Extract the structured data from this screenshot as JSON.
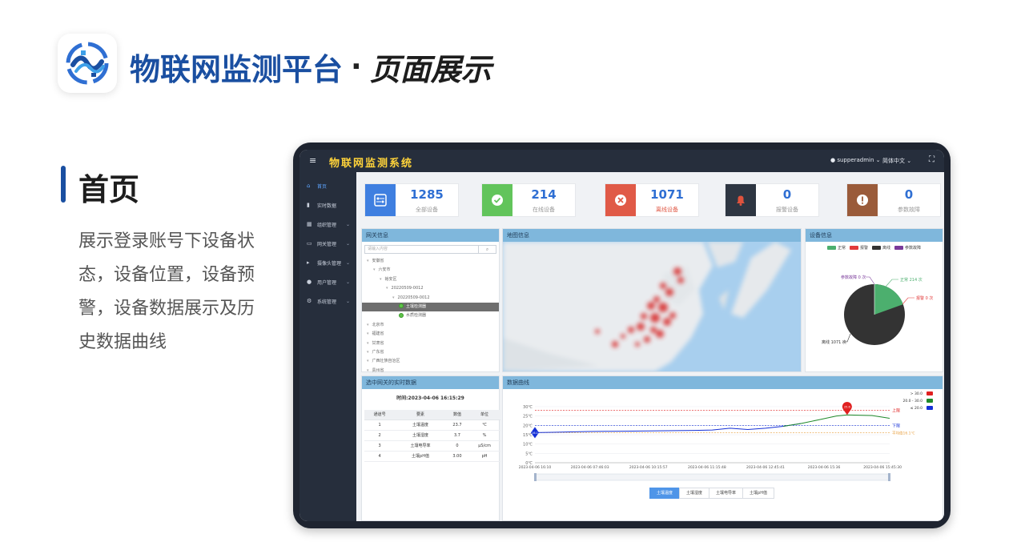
{
  "slide": {
    "title_part1": "物联网监测平台",
    "title_dot": "·",
    "title_part2": "页面展示",
    "section_title": "首页",
    "section_desc": "展示登录账号下设备状态，设备位置，设备预警，设备数据展示及历史数据曲线"
  },
  "app": {
    "menu_icon": "≡",
    "system_name": "物联网监测系统",
    "user": "supperadmin",
    "language": "简体中文",
    "fullscreen_icon": "fullscreen-icon"
  },
  "sidebar": {
    "items": [
      {
        "label": "首页",
        "icon": "home-icon"
      },
      {
        "label": "实时数据",
        "icon": "chart-icon"
      },
      {
        "label": "组织管理",
        "icon": "grid-icon"
      },
      {
        "label": "网关管理",
        "icon": "monitor-icon"
      },
      {
        "label": "摄像头管理",
        "icon": "camera-icon"
      },
      {
        "label": "用户管理",
        "icon": "user-icon"
      },
      {
        "label": "系统管理",
        "icon": "settings-icon"
      }
    ]
  },
  "stats": [
    {
      "value": "1285",
      "label": "全部设备",
      "color": "#3f7fe0",
      "icon": "device-icon"
    },
    {
      "value": "214",
      "label": "在线设备",
      "color": "#62c45b",
      "icon": "check-icon"
    },
    {
      "value": "1071",
      "label": "离线设备",
      "color": "#e05a47",
      "icon": "close-icon"
    },
    {
      "value": "0",
      "label": "报警设备",
      "color": "#2e3642",
      "icon": "bell-icon"
    },
    {
      "value": "0",
      "label": "参数故障",
      "color": "#9a5b3a",
      "icon": "warning-icon"
    }
  ],
  "gateway": {
    "title": "网关信息",
    "search_placeholder": "请输入内容",
    "tree": [
      {
        "label": "安徽省",
        "level": 0,
        "type": "node"
      },
      {
        "label": "六安市",
        "level": 1,
        "type": "node"
      },
      {
        "label": "裕安区",
        "level": 2,
        "type": "node"
      },
      {
        "label": "20220509-0012",
        "level": 3,
        "type": "node"
      },
      {
        "label": "20220509-0012",
        "level": 4,
        "type": "node"
      },
      {
        "label": "土壤检测器",
        "level": 5,
        "type": "leaf",
        "selected": true
      },
      {
        "label": "水质检测器",
        "level": 5,
        "type": "leaf"
      },
      {
        "label": "北京市",
        "level": 0,
        "type": "node"
      },
      {
        "label": "福建省",
        "level": 0,
        "type": "node"
      },
      {
        "label": "甘肃省",
        "level": 0,
        "type": "node"
      },
      {
        "label": "广东省",
        "level": 0,
        "type": "node"
      },
      {
        "label": "广西壮族自治区",
        "level": 0,
        "type": "node"
      },
      {
        "label": "贵州省",
        "level": 0,
        "type": "node"
      }
    ]
  },
  "map": {
    "title": "地图信息"
  },
  "device_info": {
    "title": "设备信息",
    "legend": [
      {
        "label": "正常",
        "color": "#4caf6e"
      },
      {
        "label": "报警",
        "color": "#e23b3b"
      },
      {
        "label": "离线",
        "color": "#333333"
      },
      {
        "label": "参数故障",
        "color": "#7a3a9a"
      }
    ],
    "labels": {
      "fault": "参数故障 0 次",
      "normal": "正常 214 次",
      "alarm": "报警 0 次",
      "offline": "离线 1071 次"
    }
  },
  "realtime": {
    "title": "选中网关的实时数据",
    "time_label": "时间:2023-04-06 16:15:29",
    "columns": [
      "通道号",
      "要素",
      "数值",
      "单位"
    ],
    "rows": [
      [
        "1",
        "土壤温度",
        "23.7",
        "℃"
      ],
      [
        "2",
        "土壤湿度",
        "3.7",
        "%"
      ],
      [
        "3",
        "土壤电导率",
        "0",
        "μS/cm"
      ],
      [
        "4",
        "土壤pH值",
        "3.00",
        "pH"
      ]
    ]
  },
  "curve": {
    "title": "数据曲线",
    "tabs": [
      "土壤温度",
      "土壤湿度",
      "土壤电导率",
      "土壤pH值"
    ],
    "active_tab": 0,
    "upper_label": "上限",
    "lower_label": "下限",
    "avg_label": "平均值16.1℃",
    "marker_label": "25.6",
    "start_marker_label": "16.1",
    "legend": [
      {
        "label": "> 30.0",
        "color": "#e02020"
      },
      {
        "label": "20.0 - 30.0",
        "color": "#1f8a2a"
      },
      {
        "label": "≤ 20.0",
        "color": "#1530d6"
      }
    ]
  },
  "chart_data": {
    "type": "line",
    "title": "数据曲线",
    "x_tick_labels": [
      "2023-04-06 16:10",
      "2023-04-06 07:46:03",
      "2023-04-06 10:15:57",
      "2023-04-06 11:15:48",
      "2023-04-06 12:45:41",
      "2023-04-06 15:36",
      "2023-04-06 15:45:30"
    ],
    "y_tick_labels": [
      "0℃",
      "5℃",
      "10℃",
      "15℃",
      "20℃",
      "25℃",
      "30℃"
    ],
    "ylim": [
      0,
      30
    ],
    "thresholds": {
      "upper": 28,
      "lower": 20,
      "average": 16.1
    },
    "series": [
      {
        "name": "土壤温度",
        "x": [
          0,
          5,
          10,
          15,
          20,
          25,
          30,
          35,
          40,
          45,
          50,
          55,
          60,
          65,
          70,
          75,
          80,
          85,
          88,
          90,
          95,
          100
        ],
        "y": [
          16.1,
          16.3,
          16.5,
          16.7,
          16.8,
          16.9,
          17.0,
          17.1,
          17.2,
          17.3,
          17.5,
          18.5,
          17.8,
          18.5,
          19.5,
          21.0,
          23.0,
          25.0,
          25.6,
          25.5,
          25.3,
          23.8
        ]
      }
    ],
    "visual_map": [
      {
        "label": "> 30.0",
        "color": "#e02020"
      },
      {
        "label": "20.0 - 30.0",
        "color": "#1f8a2a"
      },
      {
        "label": "≤ 20.0",
        "color": "#1530d6"
      }
    ]
  }
}
